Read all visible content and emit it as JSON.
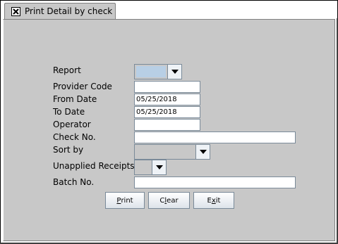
{
  "tab": {
    "title": "Print Detail by check"
  },
  "form": {
    "report_label": "Report",
    "provider_code_label": "Provider Code",
    "provider_code_value": "",
    "from_date_label": "From Date",
    "from_date_value": "05/25/2018",
    "to_date_label": "To Date",
    "to_date_value": "05/25/2018",
    "operator_label": "Operator",
    "operator_value": "",
    "check_no_label": "Check No.",
    "check_no_value": "",
    "sort_by_label": "Sort by",
    "unapplied_label": "Unapplied Receipts",
    "batch_no_label": "Batch No.",
    "batch_no_value": ""
  },
  "buttons": {
    "print_mn": "P",
    "print_rest": "rint",
    "clear_pre": "C",
    "clear_mn": "l",
    "clear_rest": "ear",
    "exit_pre": "E",
    "exit_mn": "x",
    "exit_rest": "it"
  },
  "colors": {
    "panel": "#c8c8c8",
    "combo_selected": "#b8cfe5",
    "field_border": "#7a8a99"
  },
  "icons": {
    "tab_close": "close-icon",
    "dropdown": "chevron-down-icon"
  }
}
